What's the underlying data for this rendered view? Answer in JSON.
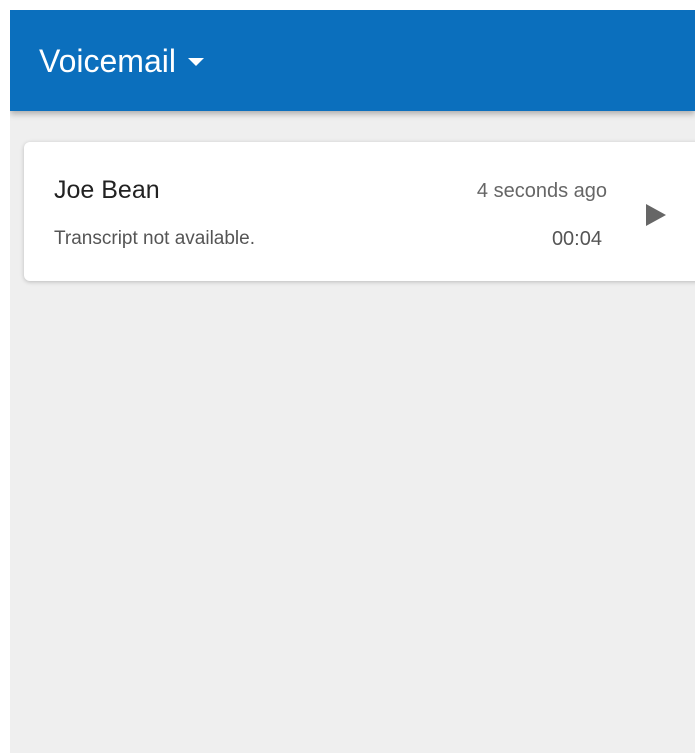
{
  "header": {
    "title": "Voicemail",
    "dropdown_icon": "caret-down-icon",
    "background_color": "#0b6fbd"
  },
  "voicemails": [
    {
      "caller": "Joe Bean",
      "time_ago": "4 seconds ago",
      "transcript": "Transcript not available.",
      "duration": "00:04",
      "action_icon": "play-icon"
    }
  ],
  "colors": {
    "background": "#efefef",
    "card": "#ffffff",
    "text_primary": "#222222",
    "text_secondary": "#666666"
  }
}
